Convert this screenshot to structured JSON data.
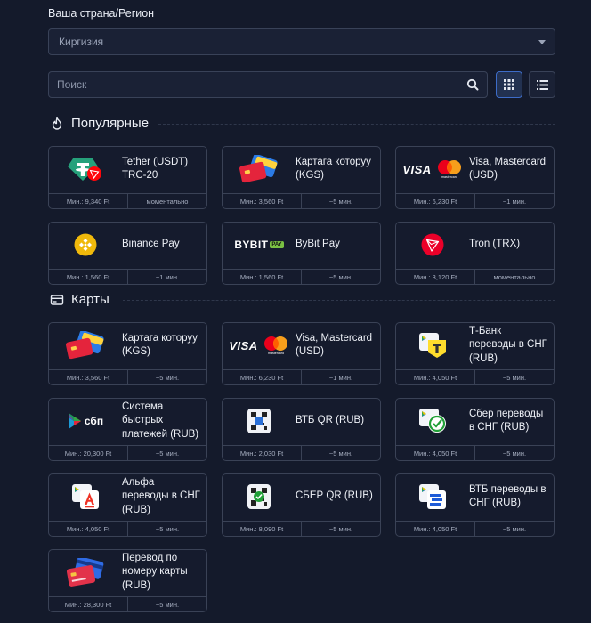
{
  "region": {
    "label": "Ваша страна/Регион",
    "selected": "Киргизия"
  },
  "search": {
    "placeholder": "Поиск"
  },
  "sections": {
    "popular": {
      "title": "Популярные"
    },
    "cards": {
      "title": "Карты"
    }
  },
  "popular": [
    {
      "name": "Tether (USDT) TRC-20",
      "min": "Мин.: 9,340 Ft",
      "time": "моментально",
      "icon": "tether-trc20-icon"
    },
    {
      "name": "Картага которуу (KGS)",
      "min": "Мин.: 3,560 Ft",
      "time": "~5 мин.",
      "icon": "bank-cards-icon"
    },
    {
      "name": "Visa, Mastercard (USD)",
      "min": "Мин.: 6,230 Ft",
      "time": "~1 мин.",
      "icon": "visa-mastercard-icon"
    },
    {
      "name": "Binance Pay",
      "min": "Мин.: 1,560 Ft",
      "time": "~1 мин.",
      "icon": "binance-icon"
    },
    {
      "name": "ByBit Pay",
      "min": "Мин.: 1,560 Ft",
      "time": "~5 мин.",
      "icon": "bybit-icon"
    },
    {
      "name": "Tron (TRX)",
      "min": "Мин.: 3,120 Ft",
      "time": "моментально",
      "icon": "tron-icon"
    }
  ],
  "cards": [
    {
      "name": "Картага которуу (KGS)",
      "min": "Мин.: 3,560 Ft",
      "time": "~5 мин.",
      "icon": "bank-cards-icon"
    },
    {
      "name": "Visa, Mastercard (USD)",
      "min": "Мин.: 6,230 Ft",
      "time": "~1 мин.",
      "icon": "visa-mastercard-icon"
    },
    {
      "name": "Т-Банк переводы в СНГ (RUB)",
      "min": "Мин.: 4,050 Ft",
      "time": "~5 мин.",
      "icon": "tbank-icon"
    },
    {
      "name": "Система быстрых платежей (RUB)",
      "min": "Мин.: 20,300 Ft",
      "time": "~5 мин.",
      "icon": "sbp-icon"
    },
    {
      "name": "ВТБ QR (RUB)",
      "min": "Мин.: 2,030 Ft",
      "time": "~5 мин.",
      "icon": "qr-vtb-icon"
    },
    {
      "name": "Сбер переводы в СНГ (RUB)",
      "min": "Мин.: 4,050 Ft",
      "time": "~5 мин.",
      "icon": "sber-transfer-icon"
    },
    {
      "name": "Альфа переводы в СНГ (RUB)",
      "min": "Мин.: 4,050 Ft",
      "time": "~5 мин.",
      "icon": "alfa-icon"
    },
    {
      "name": "СБЕР QR (RUB)",
      "min": "Мин.: 8,090 Ft",
      "time": "~5 мин.",
      "icon": "qr-sber-icon"
    },
    {
      "name": "ВТБ переводы в СНГ (RUB)",
      "min": "Мин.: 4,050 Ft",
      "time": "~5 мин.",
      "icon": "vtb-transfer-icon"
    },
    {
      "name": "Перевод по номеру карты (RUB)",
      "min": "Мин.: 28,300 Ft",
      "time": "~5 мин.",
      "icon": "card-number-icon"
    }
  ],
  "logos": {
    "visa": "VISA",
    "mastercard": "mastercard",
    "bybit": "BYBIT",
    "bybit_pay": "PAY",
    "sbp": "сбп"
  },
  "colors": {
    "background": "#141a2b",
    "card_border": "#3a4256",
    "accent": "#3d6cc8"
  }
}
